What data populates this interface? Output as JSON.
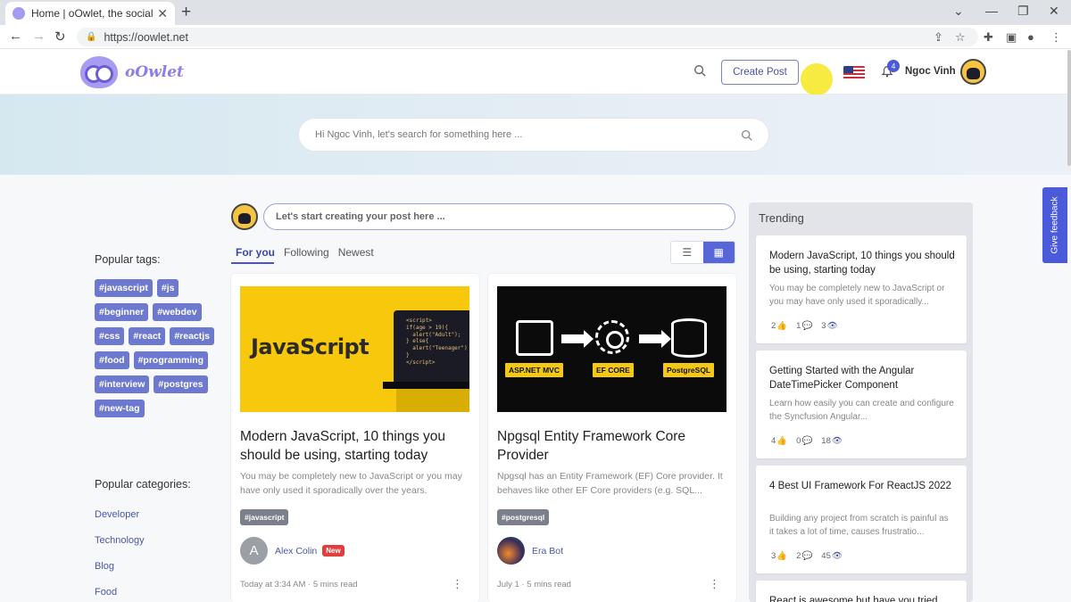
{
  "browser": {
    "tab_title": "Home | oOwlet, the social media",
    "url": "https://oowlet.net"
  },
  "header": {
    "logo_text": "oOwlet",
    "create_post": "Create Post",
    "notifications_count": "4",
    "user_name": "Ngoc Vinh"
  },
  "hero": {
    "search_placeholder": "Hi Ngoc Vinh, let's search for something here ..."
  },
  "sidebar": {
    "tags_title": "Popular tags:",
    "tags": [
      "#javascript",
      "#js",
      "#beginner",
      "#webdev",
      "#css",
      "#react",
      "#reactjs",
      "#food",
      "#programming",
      "#interview",
      "#postgres",
      "#new-tag"
    ],
    "categories_title": "Popular categories:",
    "categories": [
      "Developer",
      "Technology",
      "Blog",
      "Food"
    ]
  },
  "composer": {
    "placeholder": "Let's start creating your post here ..."
  },
  "feed_tabs": [
    "For you",
    "Following",
    "Newest"
  ],
  "posts": [
    {
      "title": "Modern JavaScript, 10 things you should be using, starting today",
      "description": "You may be completely new to JavaScript or you may have only used it sporadically over the years.",
      "tag": "#javascript",
      "author": "Alex Colin",
      "author_initial": "A",
      "badge": "New",
      "date": "Today at 3:34 AM",
      "read_time": "5 mins read",
      "thumb_title": "JavaScript"
    },
    {
      "title": "Npgsql Entity Framework Core Provider",
      "description": "Npgsql has an Entity Framework (EF) Core provider. It behaves like other EF Core providers (e.g. SQL...",
      "tag": "#postgresql",
      "author": "Era Bot",
      "date": "July 1",
      "read_time": "5 mins read",
      "thumb_labels": [
        "ASP.NET MVC",
        "EF CORE",
        "PostgreSQL"
      ]
    }
  ],
  "trending": {
    "title": "Trending",
    "items": [
      {
        "title": "Modern JavaScript, 10 things you should be using, starting today",
        "description": "You may be completely new to JavaScript or you may have only used it sporadically...",
        "likes": "2",
        "comments": "1",
        "views": "3"
      },
      {
        "title": "Getting Started with the Angular DateTimePicker Component",
        "description": "Learn how easily you can create and configure the Syncfusion Angular...",
        "likes": "4",
        "comments": "0",
        "views": "18"
      },
      {
        "title": "4 Best UI Framework For ReactJS 2022",
        "description": "Building any project from scratch is painful as it takes a lot of time, causes frustratio...",
        "likes": "3",
        "comments": "2",
        "views": "45"
      },
      {
        "title": "React is awesome but have you tried",
        "description": "",
        "likes": "",
        "comments": "",
        "views": ""
      }
    ]
  },
  "feedback": "Give feedback"
}
